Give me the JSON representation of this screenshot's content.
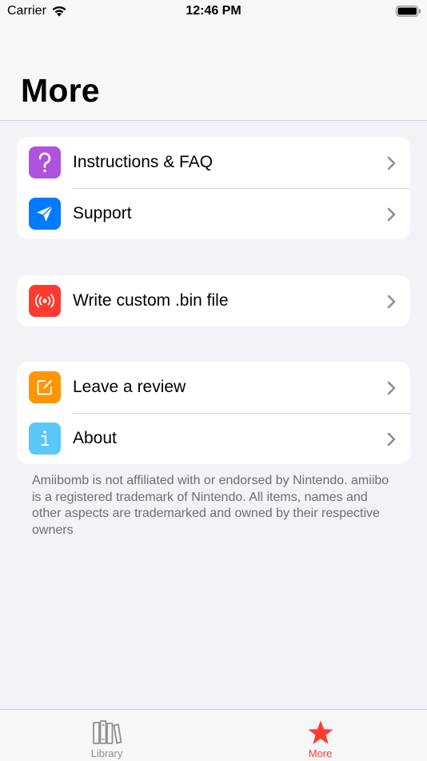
{
  "status_bar": {
    "carrier": "Carrier",
    "time": "12:46 PM"
  },
  "header": {
    "title": "More"
  },
  "groups": [
    {
      "items": [
        {
          "label": "Instructions & FAQ",
          "icon": "question-mark-icon",
          "color": "#af52de"
        },
        {
          "label": "Support",
          "icon": "paper-plane-icon",
          "color": "#007aff"
        }
      ]
    },
    {
      "items": [
        {
          "label": "Write custom .bin file",
          "icon": "nfc-broadcast-icon",
          "color": "#ff3b30"
        }
      ]
    },
    {
      "items": [
        {
          "label": "Leave a review",
          "icon": "compose-icon",
          "color": "#ff9500"
        },
        {
          "label": "About",
          "icon": "info-icon",
          "color": "#5ac8fa"
        }
      ]
    }
  ],
  "footer_note": "Amiibomb is not affiliated with or endorsed by Nintendo. amiibo is a registered trademark of Nintendo. All items, names and other aspects are trademarked and owned by their respective owners",
  "tab_bar": {
    "tabs": [
      {
        "label": "Library",
        "icon": "books-icon",
        "selected": false,
        "color": "#8e8e93"
      },
      {
        "label": "More",
        "icon": "star-icon",
        "selected": true,
        "color": "#ff3b30"
      }
    ]
  }
}
